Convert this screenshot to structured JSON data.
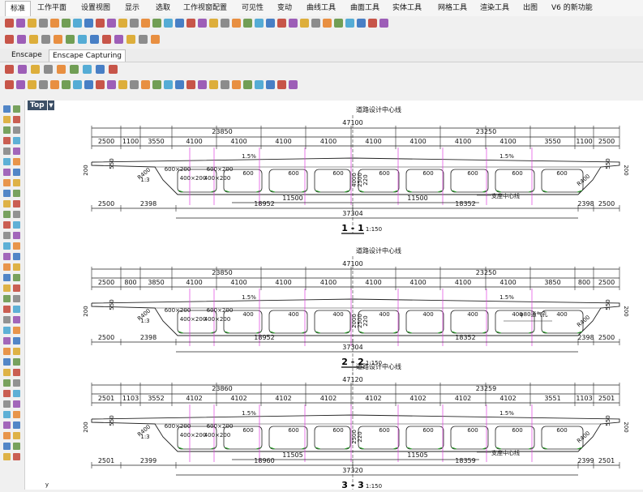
{
  "menu": {
    "items": [
      "标准",
      "工作平面",
      "设置视图",
      "显示",
      "选取",
      "工作视窗配置",
      "可见性",
      "变动",
      "曲线工具",
      "曲面工具",
      "实体工具",
      "网格工具",
      "渲染工具",
      "出图",
      "V6 的新功能"
    ]
  },
  "tabs": [
    "Enscape",
    "Enscape Capturing"
  ],
  "viewport": {
    "label": "Top",
    "axis_label": "y"
  },
  "sections": [
    {
      "title": "1 - 1",
      "scale": "1:150",
      "centerline_label": "道路设计中心线",
      "total_width": "47100",
      "half_left": "23850",
      "half_right": "23250",
      "top_dims": [
        "2500",
        "1100",
        "3550",
        "4100",
        "4100",
        "4100",
        "4100",
        "4100",
        "4100",
        "4100",
        "4100",
        "3550",
        "1100",
        "2500"
      ],
      "slope_left": "1.5%",
      "slope_right": "1.5%",
      "cell_labels": [
        "600",
        "600",
        "600",
        "600",
        "600",
        "600",
        "600",
        "600"
      ],
      "diaphragm_labels": [
        "600×200",
        "600×200",
        "400×200",
        "400×200"
      ],
      "web_labels": [
        "4000",
        "2500",
        "220"
      ],
      "edge_dims": [
        "200",
        "550",
        "550",
        "200"
      ],
      "support_label": "支座中心线",
      "mid_dims": [
        "11500",
        "11500"
      ],
      "bottom_dims": [
        "2500",
        "2398",
        "18952",
        "18352",
        "2398",
        "2500"
      ],
      "bottom_total": "37304",
      "ratio_label": "1:3",
      "corner_label": "R400"
    },
    {
      "title": "2 - 2",
      "scale": "1:150",
      "centerline_label": "道路设计中心线",
      "total_width": "47100",
      "half_left": "23850",
      "half_right": "23250",
      "top_dims": [
        "2500",
        "800",
        "3850",
        "4100",
        "4100",
        "4100",
        "4100",
        "4100",
        "4100",
        "4100",
        "4100",
        "3850",
        "800",
        "2500"
      ],
      "slope_left": "1.5%",
      "slope_right": "1.5%",
      "cell_labels": [
        "400",
        "400",
        "400",
        "400",
        "400",
        "400",
        "400",
        "400"
      ],
      "diaphragm_labels": [
        "600×200",
        "600×200",
        "400×200",
        "400×200"
      ],
      "web_labels": [
        "2000",
        "2500",
        "220"
      ],
      "edge_dims": [
        "200",
        "550",
        "550",
        "200"
      ],
      "vent_label": "φ80通气孔",
      "bottom_dims": [
        "2500",
        "2398",
        "18952",
        "18352",
        "2398",
        "2500"
      ],
      "bottom_total": "37304",
      "ratio_label": "1:3",
      "corner_label": "R400"
    },
    {
      "title": "3 - 3",
      "scale": "1:150",
      "centerline_label": "道路设计中心线",
      "total_width": "47120",
      "half_left": "23860",
      "half_right": "23259",
      "top_dims": [
        "2501",
        "1103",
        "3552",
        "4102",
        "4102",
        "4102",
        "4102",
        "4102",
        "4102",
        "4102",
        "4102",
        "3551",
        "1103",
        "2501"
      ],
      "slope_left": "1.5%",
      "slope_right": "1.5%",
      "cell_labels": [
        "600",
        "600",
        "600",
        "600",
        "600",
        "600",
        "600",
        "600"
      ],
      "diaphragm_labels": [
        "600×200",
        "600×200",
        "400×200",
        "400×200"
      ],
      "web_labels": [
        "2500",
        "220"
      ],
      "edge_dims": [
        "200",
        "550",
        "550",
        "200"
      ],
      "support_label": "支座中心线",
      "mid_dims": [
        "11505",
        "11505"
      ],
      "bottom_dims": [
        "2501",
        "2399",
        "18960",
        "18359",
        "2399",
        "2501"
      ],
      "bottom_total": "37320",
      "ratio_label": "1:3",
      "corner_label": "R400"
    }
  ],
  "colors": {
    "menu_bg": "#f5f5f5",
    "viewport_bg": "#ffffff",
    "viewport_label_bg": "#3c4f66",
    "magenta_lines": "#e040e0",
    "green_fillets": "#2aa02a",
    "line_color": "#222222"
  },
  "icons": [
    "new-file-icon",
    "open-icon",
    "save-icon",
    "print-icon",
    "cut-icon",
    "copy-icon",
    "paste-icon",
    "undo-icon",
    "pan-icon",
    "rotate-icon",
    "zoom-icon",
    "zoom-window-icon",
    "zoom-extents-icon",
    "grid-icon",
    "osnap-icon",
    "render-icon",
    "sphere-icon",
    "light-icon",
    "help-icon"
  ]
}
